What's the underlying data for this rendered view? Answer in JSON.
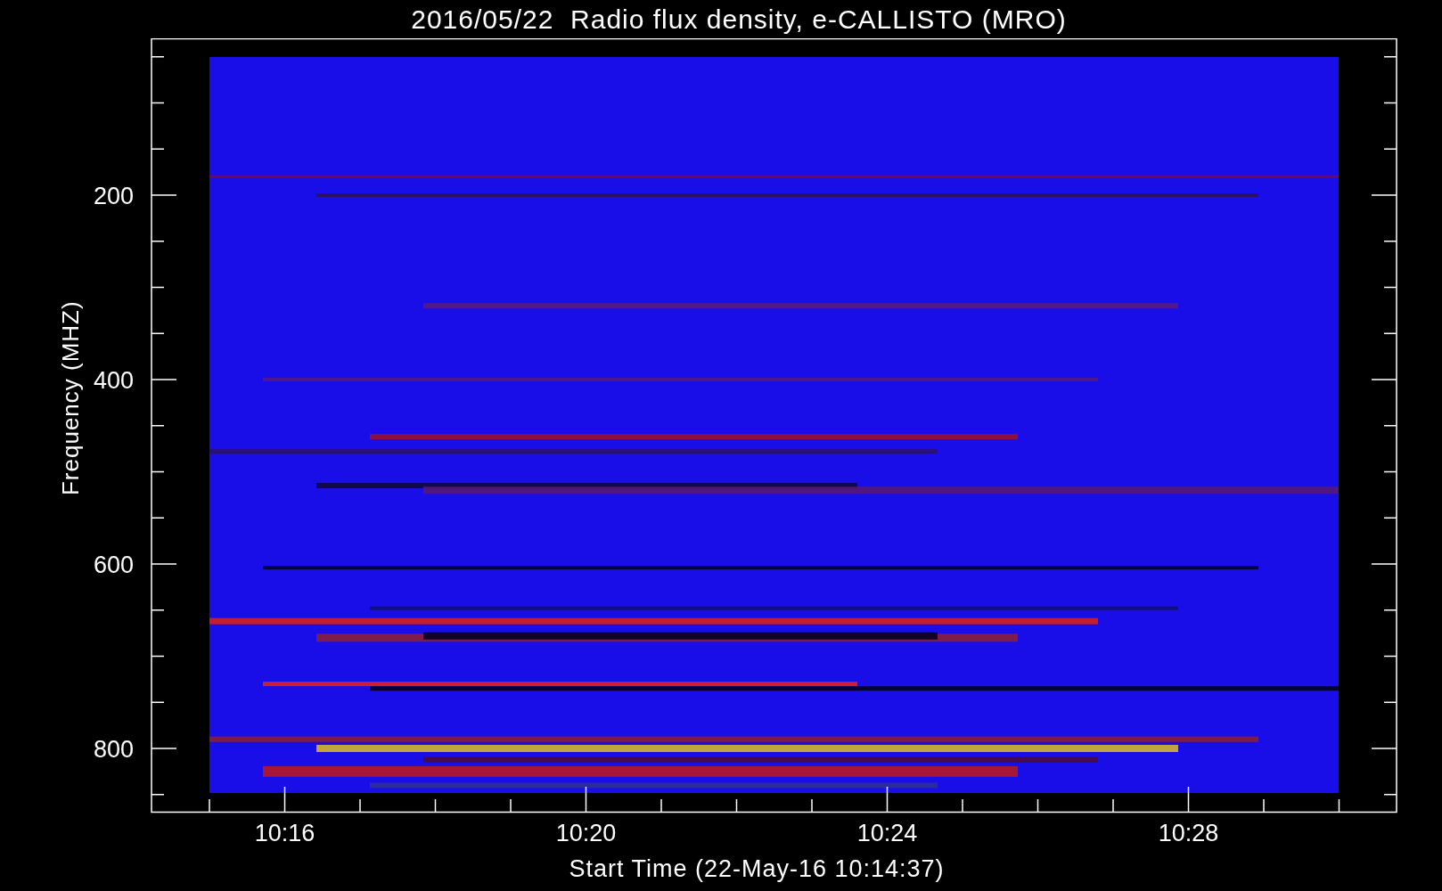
{
  "title": "2016/05/22  Radio flux density, e-CALLISTO (MRO)",
  "y_axis": {
    "label": "Frequency (MHZ)",
    "ticks": [
      "200",
      "400",
      "600",
      "800"
    ]
  },
  "x_axis": {
    "label": "Start Time (22-May-16 10:14:37)",
    "ticks": [
      "10:16",
      "10:20",
      "10:24",
      "10:28"
    ]
  }
}
